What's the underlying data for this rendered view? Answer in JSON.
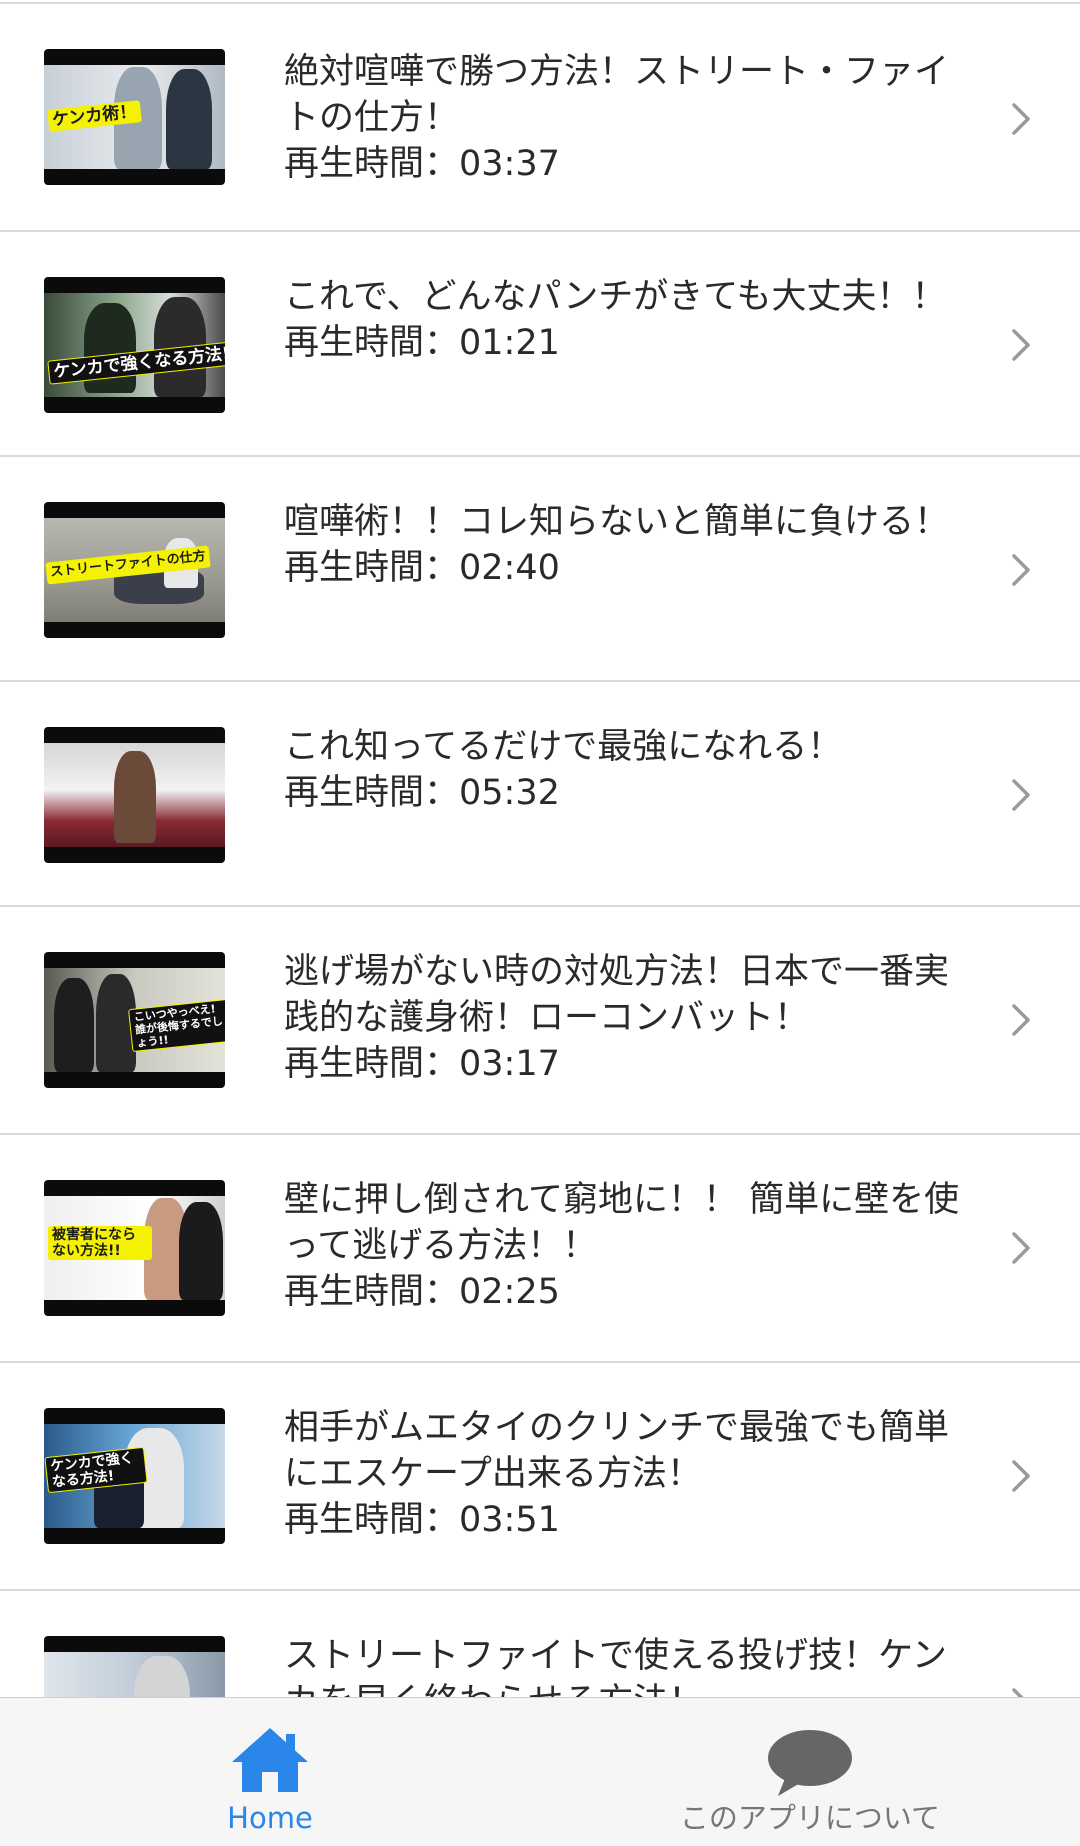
{
  "videos": [
    {
      "title": "絶対喧嘩で勝つ方法！ストリート・ファイトの仕方！",
      "duration": "再生時間：03:37",
      "thumb_caption": "ケンカ術！"
    },
    {
      "title": "これで、どんなパンチがきても大丈夫！！",
      "duration": "再生時間：01:21",
      "thumb_caption": "ケンカで強くなる方法!"
    },
    {
      "title": "喧嘩術！！コレ知らないと簡単に負ける！",
      "duration": "再生時間：02:40",
      "thumb_caption": "ストリートファイトの仕方"
    },
    {
      "title": "これ知ってるだけで最強になれる！",
      "duration": "再生時間：05:32",
      "thumb_caption": ""
    },
    {
      "title": "逃げ場がない時の対処方法！日本で一番実践的な護身術！ローコンバット！",
      "duration": "再生時間：03:17",
      "thumb_caption": "こいつやっべえ! 誰が後悔するでしょう!!"
    },
    {
      "title": "壁に押し倒されて窮地に！！ 簡単に壁を使って逃げる方法！！",
      "duration": "再生時間：02:25",
      "thumb_caption": "被害者にならない方法!!"
    },
    {
      "title": "相手がムエタイのクリンチで最強でも簡単にエスケープ出来る方法！",
      "duration": "再生時間：03:51",
      "thumb_caption": "ケンカで強くなる方法!"
    },
    {
      "title": "ストリートファイトで使える投げ技！ケンカを早く終わらせる方法！",
      "duration": "",
      "thumb_caption": ""
    }
  ],
  "tabs": {
    "home_label": "Home",
    "about_label": "このアプリについて"
  },
  "colors": {
    "accent": "#2a86e8",
    "separator": "#d9d9d9",
    "tabbar_bg": "#f6f6f6",
    "inactive": "#777777",
    "caption_yellow": "#f4f200"
  },
  "icons": {
    "row_action": "chevron-right-icon",
    "home_tab": "home-icon",
    "about_tab": "speech-bubble-icon"
  }
}
